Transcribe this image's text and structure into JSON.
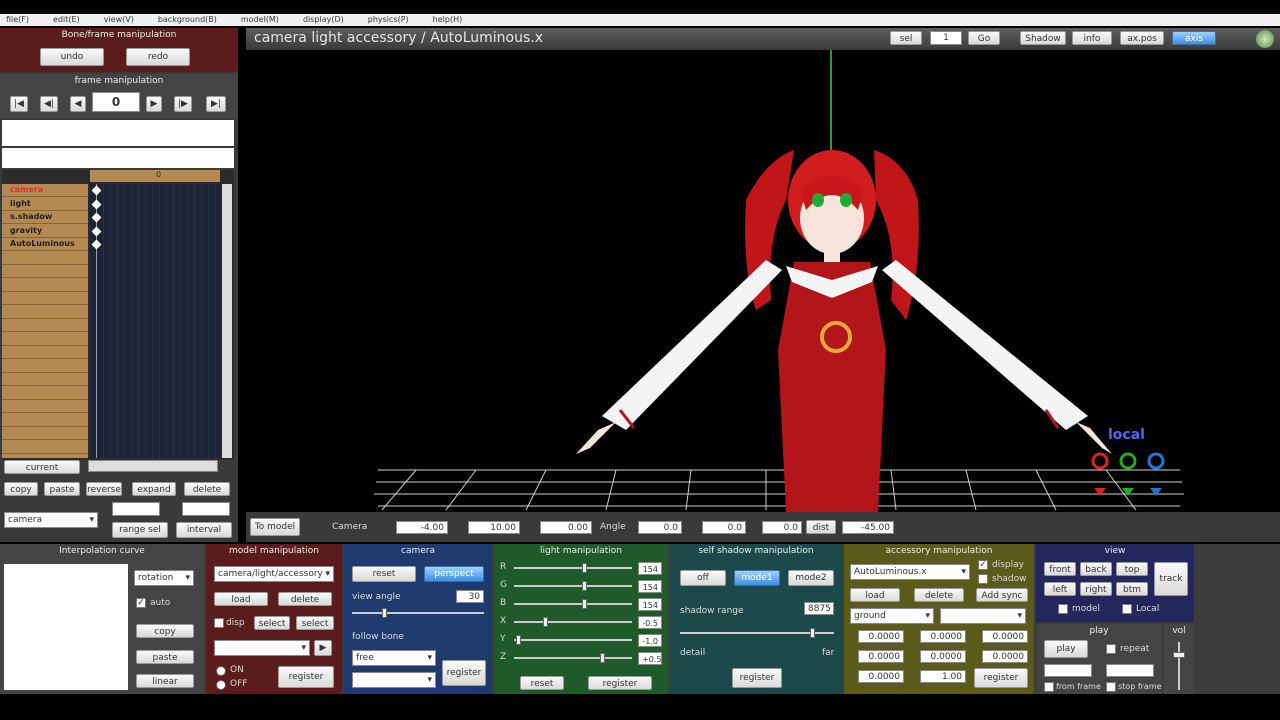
{
  "menubar": {
    "items": [
      "file(F)",
      "edit(E)",
      "view(V)",
      "background(B)",
      "model(M)",
      "display(D)",
      "physics(P)",
      "help(H)"
    ]
  },
  "bone_frame": {
    "title": "Bone/frame manipulation",
    "undo": "undo",
    "redo": "redo"
  },
  "frame_nav": {
    "title": "frame manipulation",
    "frame_value": "0",
    "btn_first": "|◀",
    "btn_prevkey": "◀|",
    "btn_prev": "◀",
    "btn_next": "▶",
    "btn_nextkey": "|▶",
    "btn_last": "▶|"
  },
  "timeline": {
    "header_marker": "0",
    "items": [
      "camera",
      "light",
      "s.shadow",
      "gravity",
      "AutoLuminous"
    ],
    "current_btn": "current",
    "btns": {
      "copy": "copy",
      "paste": "paste",
      "reverse": "reverse",
      "expand": "expand",
      "delete": "delete"
    },
    "camera_select": "camera",
    "range_sel": "range sel",
    "interval": "interval"
  },
  "viewport": {
    "title": "camera light accessory / AutoLuminous.x",
    "toolbar": {
      "sel": "sel",
      "frame_val": "1",
      "go": "Go",
      "shadow": "Shadow",
      "info": "info",
      "axpos": "ax.pos",
      "axis": "axis"
    },
    "local_label": "local",
    "to_model": "To model",
    "coords": {
      "label": "Camera",
      "x": "-4.00",
      "y": "10.00",
      "z": "0.00",
      "angle_label": "Angle",
      "ax": "0.0",
      "ay": "0.0",
      "az": "0.0",
      "dist_label": "dist",
      "dist": "-45.00"
    }
  },
  "interp": {
    "title": "Interpolation curve",
    "rotation": "rotation",
    "auto": "auto",
    "copy": "copy",
    "paste": "paste",
    "linear": "linear"
  },
  "model_panel": {
    "title": "model manipulation",
    "select": "camera/light/accessory",
    "load": "load",
    "delete": "delete",
    "disp": "disp",
    "select_btn": "select",
    "stop_btn": "select",
    "on": "ON",
    "off": "OFF",
    "register": "register"
  },
  "camera_panel": {
    "title": "camera",
    "reset": "reset",
    "perspect": "perspect",
    "view_angle": "view angle",
    "view_angle_val": "30",
    "follow_bone": "follow bone",
    "follow_val": "free",
    "register": "register"
  },
  "light_panel": {
    "title": "light manipulation",
    "r_lbl": "R",
    "g_lbl": "G",
    "b_lbl": "B",
    "x_lbl": "X",
    "y_lbl": "Y",
    "z_lbl": "Z",
    "r": "154",
    "g": "154",
    "b": "154",
    "x": "-0.5",
    "y": "-1.0",
    "z": "+0.5",
    "reset": "reset",
    "register": "register"
  },
  "shadow_panel": {
    "title": "self shadow manipulation",
    "off": "off",
    "mode1": "mode1",
    "mode2": "mode2",
    "range": "shadow range",
    "range_val": "8875",
    "detail": "detail",
    "far": "far",
    "register": "register"
  },
  "accessory_panel": {
    "title": "accessory manipulation",
    "select": "AutoLuminous.x",
    "display": "display",
    "shadow": "shadow",
    "load": "load",
    "delete": "delete",
    "add_sync": "Add sync",
    "ground": "ground",
    "x": "0.0000",
    "y": "0.0000",
    "z": "0.0000",
    "rx": "0.0000",
    "ry": "0.0000",
    "rz": "0.0000",
    "si": "0.0000",
    "tr": "1.00",
    "register": "register"
  },
  "view_panel": {
    "title": "view",
    "front": "front",
    "back": "back",
    "top": "top",
    "left": "left",
    "right": "right",
    "btm": "btm",
    "track": "track",
    "model": "model",
    "local": "Local"
  },
  "play_panel": {
    "title": "play",
    "play": "play",
    "repeat": "repeat",
    "from_frame": "from frame",
    "stop_frame": "stop frame"
  },
  "vol_panel": {
    "title": "vol"
  },
  "colors": {
    "panel_maroon": "#5a1c1c",
    "panel_blue": "#1f3a6e",
    "panel_green": "#1f5a2a",
    "panel_teal": "#1c4a4a",
    "panel_olive": "#5a5a1a",
    "panel_navy": "#23275c",
    "timeline_tan": "#b58a52"
  }
}
